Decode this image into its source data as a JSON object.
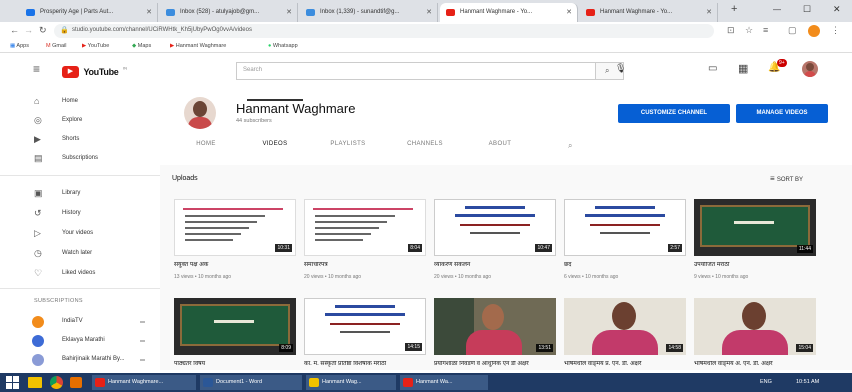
{
  "browser": {
    "tabs": [
      {
        "label": "Prosperity Age | Parts Aut...",
        "color": "#1a73e8"
      },
      {
        "label": "Inbox (528) - atulyajob@gm...",
        "color": "#3c8dde"
      },
      {
        "label": "Inbox (1,339) - sunandtif@g...",
        "color": "#3c8dde"
      },
      {
        "label": "Hanmant Waghmare - Yo...",
        "color": "#e62117"
      },
      {
        "label": "Hanmant Waghmare - Yo...",
        "color": "#e62117"
      }
    ],
    "new_tab": "+",
    "url": "studio.youtube.com/channel/UCiRWHtk_Kh5jUbyPwOg0vvA/videos",
    "bookmarks": [
      "Apps",
      "Gmail",
      "YouTube",
      "Maps",
      "Hanmant Waghmare",
      "Whatsapp"
    ],
    "controls": {
      "min": "—",
      "max": "☐",
      "close": "✕"
    }
  },
  "youtube": {
    "logo_text": "YouTube",
    "logo_sup": "IN",
    "search_placeholder": "Search",
    "notif_count": "9+",
    "sidebar": {
      "main": [
        {
          "icon": "⌂",
          "label": "Home"
        },
        {
          "icon": "◎",
          "label": "Explore"
        },
        {
          "icon": "▶",
          "label": "Shorts"
        },
        {
          "icon": "▤",
          "label": "Subscriptions"
        }
      ],
      "library": [
        {
          "icon": "▣",
          "label": "Library"
        },
        {
          "icon": "↺",
          "label": "History"
        },
        {
          "icon": "▷",
          "label": "Your videos"
        },
        {
          "icon": "◷",
          "label": "Watch later"
        },
        {
          "icon": "♡",
          "label": "Liked videos"
        }
      ],
      "subscriptions_heading": "SUBSCRIPTIONS",
      "subscriptions": [
        {
          "label": "IndiaTV",
          "color": "#f28c1b"
        },
        {
          "label": "Eklavya Marathi",
          "color": "#3d6bd6"
        },
        {
          "label": "Bahirjinaik Marathi By...",
          "color": "#8a9bd6"
        }
      ]
    },
    "channel": {
      "name": "Hanmant Waghmare",
      "subscribers": "44 subscribers",
      "customize_label": "CUSTOMIZE CHANNEL",
      "manage_label": "MANAGE VIDEOS",
      "tabs": [
        "HOME",
        "VIDEOS",
        "PLAYLISTS",
        "CHANNELS",
        "ABOUT"
      ],
      "active_tab": "VIDEOS"
    },
    "uploads_label": "Uploads",
    "sort_label": "SORT BY",
    "videos": [
      {
        "title": "संयुक्त पक्ष अंक",
        "meta": "13 views • 10 months ago",
        "duration": "10:31",
        "style": "slide-white"
      },
      {
        "title": "समाचारपत्र",
        "meta": "20 views • 10 months ago",
        "duration": "8:04",
        "style": "slide-white"
      },
      {
        "title": "व्याकरण संकलन",
        "meta": "20 views • 10 months ago",
        "duration": "10:47",
        "style": "slide-title"
      },
      {
        "title": "छंद",
        "meta": "6 views • 10 months ago",
        "duration": "2:57",
        "style": "slide-title"
      },
      {
        "title": "उपयोजित मराठी",
        "meta": "9 views • 10 months ago",
        "duration": "11:44",
        "style": "board"
      },
      {
        "title": "पाठ्येतर विषय",
        "meta": "",
        "duration": "8:09",
        "style": "board"
      },
      {
        "title": "का. म. संस्कृती प्रतिष्ठा विशेषांक मराठी",
        "meta": "",
        "duration": "14:15",
        "style": "slide-title"
      },
      {
        "title": "प्रयोगशाळा निवडणे व आधुनिक एन डी अक्षरे",
        "meta": "",
        "duration": "13:51",
        "style": "person-room"
      },
      {
        "title": "भाषेमधील वाङ्‌मय प्र. एन. डी. अक्षरे",
        "meta": "",
        "duration": "14:58",
        "style": "person"
      },
      {
        "title": "भाषेमधील वाङ्‌मय अ. एन. डी. अक्षरे",
        "meta": "",
        "duration": "15:04",
        "style": "person"
      }
    ]
  },
  "taskbar": {
    "tasks": [
      {
        "label": "Hanmant Waghmare...",
        "color": "#e62117"
      },
      {
        "label": "Document1 - Word",
        "color": "#2b5797"
      },
      {
        "label": "Hanmant Wag...",
        "color": "#f2c200"
      },
      {
        "label": "Hanmant Wa...",
        "color": "#e62117"
      }
    ],
    "tray_lang": "ENG",
    "clock": "10:51 AM"
  }
}
